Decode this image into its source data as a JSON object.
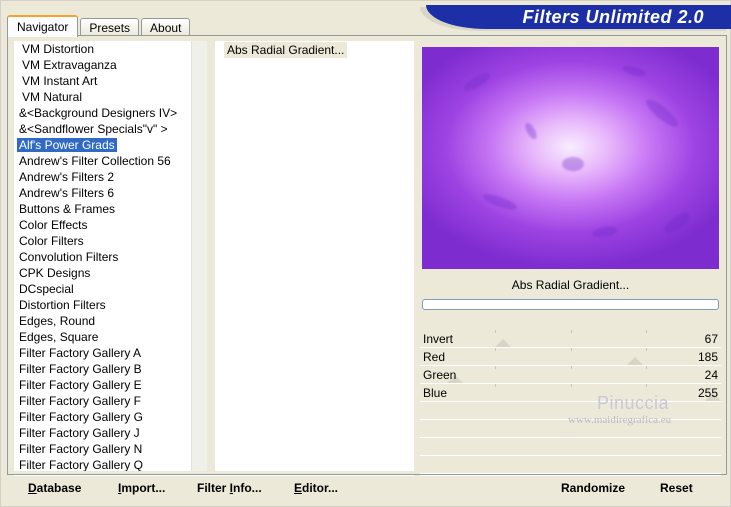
{
  "tabs": [
    {
      "label": "Navigator",
      "active": true
    },
    {
      "label": "Presets",
      "active": false
    },
    {
      "label": "About",
      "active": false
    }
  ],
  "app_title": "Filters Unlimited 2.0",
  "categories": [
    "VM Distortion",
    "VM Extravaganza",
    "VM Instant Art",
    "VM Natural",
    "&<Background Designers IV>",
    "&<Sandflower Specials\"v\" >",
    "Alf's Power Grads",
    "Andrew's Filter Collection 56",
    "Andrew's Filters 2",
    "Andrew's Filters 6",
    "Buttons & Frames",
    "Color Effects",
    "Color Filters",
    "Convolution Filters",
    "CPK Designs",
    "DCspecial",
    "Distortion Filters",
    "Edges, Round",
    "Edges, Square",
    "Filter Factory Gallery A",
    "Filter Factory Gallery B",
    "Filter Factory Gallery E",
    "Filter Factory Gallery F",
    "Filter Factory Gallery G",
    "Filter Factory Gallery J",
    "Filter Factory Gallery N",
    "Filter Factory Gallery Q"
  ],
  "selected_category": "Alf's Power Grads",
  "filters": [
    "Abs Radial Gradient..."
  ],
  "current_filter": "Abs Radial Gradient...",
  "params": [
    {
      "label": "Invert",
      "value": "67",
      "level": 67
    },
    {
      "label": "Red",
      "value": "185",
      "level": 185
    },
    {
      "label": "Green",
      "value": "24",
      "level": 24
    },
    {
      "label": "Blue",
      "value": "255",
      "level": 255
    }
  ],
  "watermark": {
    "line1": "Pinuccia",
    "line2": "www.maidiregrafica.eu"
  },
  "buttons": {
    "database": {
      "pre": "",
      "u": "D",
      "post": "atabase"
    },
    "import": {
      "pre": "",
      "u": "I",
      "post": "mport..."
    },
    "filter_info": {
      "pre": "Filter ",
      "u": "I",
      "post": "nfo..."
    },
    "editor": {
      "pre": "",
      "u": "E",
      "post": "ditor..."
    },
    "randomize": "Randomize",
    "reset": "Reset"
  },
  "colors": {
    "banner": "#1c2fa6",
    "selection": "#316ac5",
    "preview_core": "#f8eefe",
    "preview_edge": "#7d2ccf"
  }
}
